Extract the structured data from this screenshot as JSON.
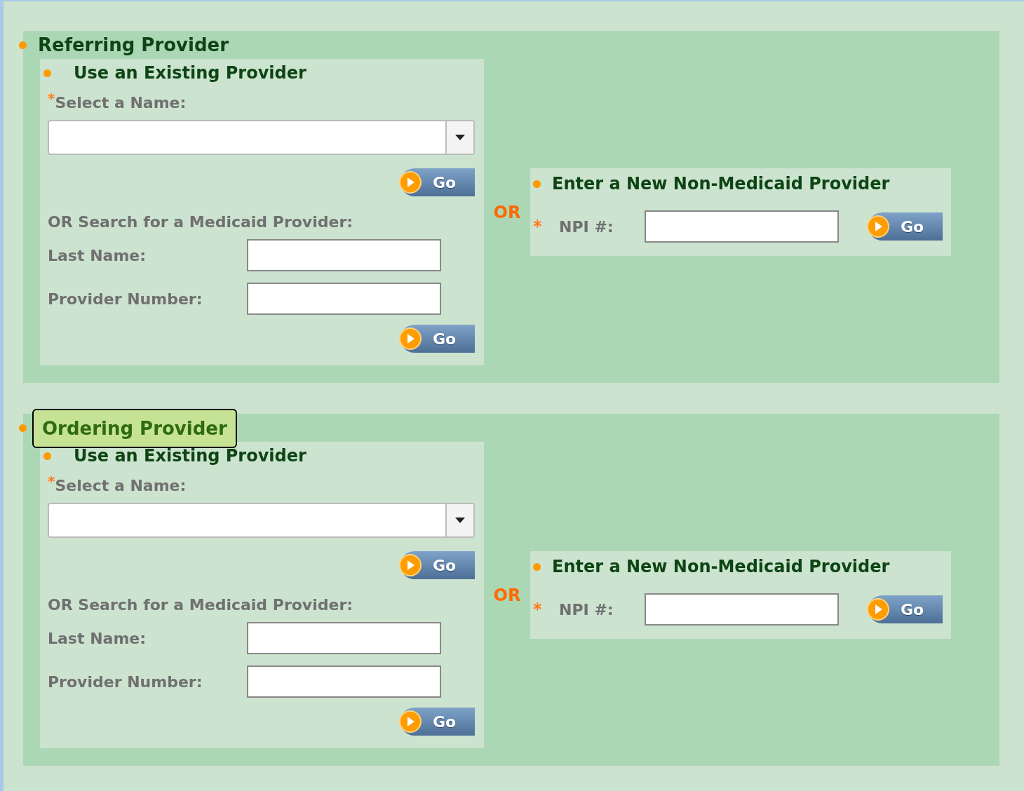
{
  "sections": [
    {
      "title": "Referring Provider",
      "highlighted": false,
      "existing": {
        "heading": "Use an Existing Provider",
        "required_mark": "*",
        "select_label": "Select a Name:",
        "go": "Go",
        "search_heading": "OR Search for a Medicaid Provider:",
        "fields": [
          {
            "label": "Last Name:"
          },
          {
            "label": "Provider Number:"
          }
        ],
        "search_go": "Go"
      },
      "or": "OR",
      "new": {
        "heading": "Enter a New Non-Medicaid Provider",
        "required_mark": "*",
        "field_label": "NPI #:",
        "go": "Go"
      }
    },
    {
      "title": "Ordering Provider",
      "highlighted": true,
      "existing": {
        "heading": "Use an Existing Provider",
        "required_mark": "*",
        "select_label": "Select a Name:",
        "go": "Go",
        "search_heading": "OR Search for a Medicaid Provider:",
        "fields": [
          {
            "label": "Last Name:"
          },
          {
            "label": "Provider Number:"
          }
        ],
        "search_go": "Go"
      },
      "or": "OR",
      "new": {
        "heading": "Enter a New Non-Medicaid Provider",
        "required_mark": "*",
        "field_label": "NPI #:",
        "go": "Go"
      }
    }
  ]
}
